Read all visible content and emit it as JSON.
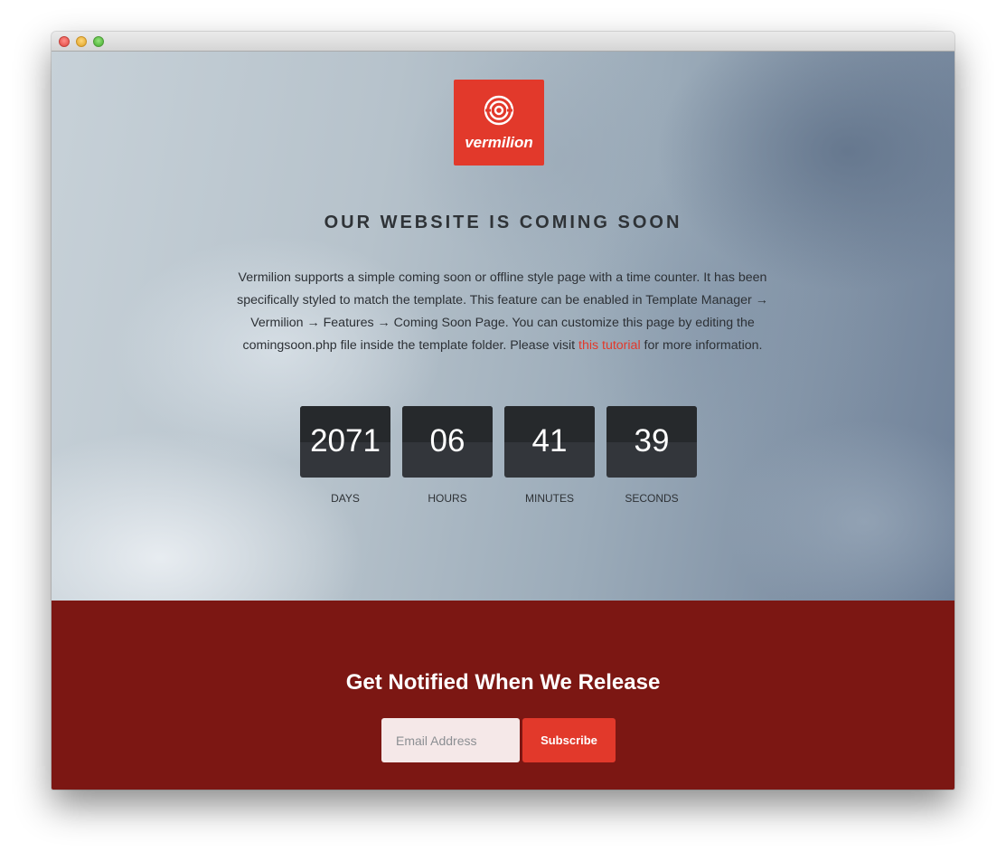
{
  "brand": {
    "name": "vermilion",
    "icon": "target-rings-icon",
    "accent_color": "#e2392b"
  },
  "hero": {
    "headline": "OUR WEBSITE IS COMING SOON",
    "description_before_link": "Vermilion supports a simple coming soon or offline style page with a time counter. It has been specifically styled to match the template. This feature can be enabled in Template Manager → Vermilion → Features → Coming Soon Page. You can customize this page by editing the comingsoon.php file inside the template folder. Please visit ",
    "link_text": "this tutorial",
    "description_after_link": " for more information."
  },
  "countdown": [
    {
      "value": "2071",
      "label": "DAYS"
    },
    {
      "value": "06",
      "label": "HOURS"
    },
    {
      "value": "41",
      "label": "MINUTES"
    },
    {
      "value": "39",
      "label": "SECONDS"
    }
  ],
  "notify": {
    "title": "Get Notified When We Release",
    "email_placeholder": "Email Address",
    "email_value": "",
    "subscribe_label": "Subscribe",
    "background_color": "#7c1713"
  }
}
